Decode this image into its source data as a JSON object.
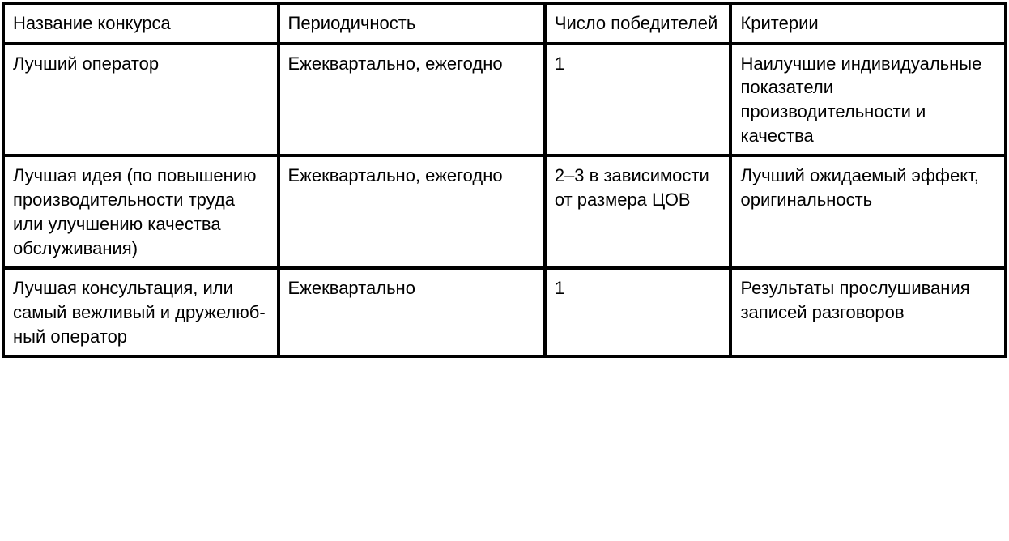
{
  "headers": {
    "name": "Название конкурса",
    "periodicity": "Периодичность",
    "winners": "Число победителей",
    "criteria": "Критерии"
  },
  "rows": [
    {
      "name": "Лучший оператор",
      "periodicity": "Ежеквартально, еже­годно",
      "winners": "1",
      "criteria": "Наилучшие индиви­дуальные показатели производительности и качества"
    },
    {
      "name": "Лучшая идея (по повышению производительности труда или улучшению качества обслужи­вания)",
      "periodicity": "Ежеквартально, еже­годно",
      "winners": "2–3 в зависи­мости от раз­мера ЦОВ",
      "criteria": "Лучший ожидаемый эффект, оригиналь­ность"
    },
    {
      "name": "Лучшая консульта­ция, или самый веж­ливый и дружелюб­ный оператор",
      "periodicity": "Ежеквартально",
      "winners": "1",
      "criteria": "Результаты прослу­шивания записей разговоров"
    }
  ]
}
